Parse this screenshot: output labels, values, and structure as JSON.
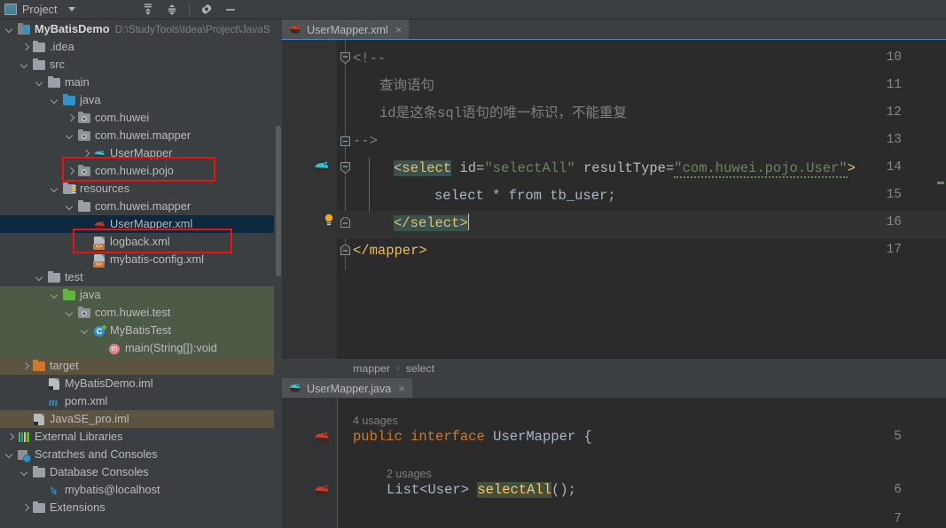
{
  "toolbar": {
    "panel_title": "Project",
    "icons": {
      "project": "project-panel-icon",
      "dropdown": "chevron-down-icon",
      "expand_all": "expand-all-icon",
      "collapse_all": "collapse-all-icon",
      "settings": "gear-icon",
      "hide": "minimize-icon"
    }
  },
  "tree": {
    "items": [
      {
        "label": "MyBatisDemo",
        "path": "D:\\StudyTools\\Idea\\Project\\JavaS",
        "indent": 0,
        "arrow": "down",
        "icon": "module-icon",
        "bold": true,
        "bg": "none"
      },
      {
        "label": ".idea",
        "path": "",
        "indent": 1,
        "arrow": "right",
        "icon": "folder-grey-icon",
        "bold": false,
        "bg": "none"
      },
      {
        "label": "src",
        "path": "",
        "indent": 1,
        "arrow": "down",
        "icon": "folder-grey-icon",
        "bold": false,
        "bg": "none"
      },
      {
        "label": "main",
        "path": "",
        "indent": 2,
        "arrow": "down",
        "icon": "folder-grey-icon",
        "bold": false,
        "bg": "none"
      },
      {
        "label": "java",
        "path": "",
        "indent": 3,
        "arrow": "down",
        "icon": "folder-blue-icon",
        "bold": false,
        "bg": "none"
      },
      {
        "label": "com.huwei",
        "path": "",
        "indent": 4,
        "arrow": "right",
        "icon": "package-icon",
        "bold": false,
        "bg": "none"
      },
      {
        "label": "com.huwei.mapper",
        "path": "",
        "indent": 4,
        "arrow": "down",
        "icon": "package-icon",
        "bold": false,
        "bg": "none"
      },
      {
        "label": "UserMapper",
        "path": "",
        "indent": 5,
        "arrow": "right",
        "icon": "mybatis-mapper-icon",
        "bold": false,
        "bg": "none"
      },
      {
        "label": "com.huwei.pojo",
        "path": "",
        "indent": 4,
        "arrow": "right",
        "icon": "package-icon",
        "bold": false,
        "bg": "none"
      },
      {
        "label": "resources",
        "path": "",
        "indent": 3,
        "arrow": "down",
        "icon": "folder-resources-icon",
        "bold": false,
        "bg": "none"
      },
      {
        "label": "com.huwei.mapper",
        "path": "",
        "indent": 4,
        "arrow": "down",
        "icon": "folder-grey-icon",
        "bold": false,
        "bg": "none"
      },
      {
        "label": "UserMapper.xml",
        "path": "",
        "indent": 5,
        "arrow": "none",
        "icon": "mybatis-file-icon",
        "bold": false,
        "bg": "selected"
      },
      {
        "label": "logback.xml",
        "path": "",
        "indent": 5,
        "arrow": "none",
        "icon": "xml-file-icon",
        "bold": false,
        "bg": "none"
      },
      {
        "label": "mybatis-config.xml",
        "path": "",
        "indent": 5,
        "arrow": "none",
        "icon": "xml-file-icon",
        "bold": false,
        "bg": "none"
      },
      {
        "label": "test",
        "path": "",
        "indent": 2,
        "arrow": "down",
        "icon": "folder-grey-icon",
        "bold": false,
        "bg": "none"
      },
      {
        "label": "java",
        "path": "",
        "indent": 3,
        "arrow": "down",
        "icon": "folder-green-icon",
        "bold": false,
        "bg": "green"
      },
      {
        "label": "com.huwei.test",
        "path": "",
        "indent": 4,
        "arrow": "down",
        "icon": "package-icon",
        "bold": false,
        "bg": "green"
      },
      {
        "label": "MyBatisTest",
        "path": "",
        "indent": 5,
        "arrow": "down",
        "icon": "java-class-icon",
        "bold": false,
        "bg": "green"
      },
      {
        "label": "main(String[]):void",
        "path": "",
        "indent": 6,
        "arrow": "none",
        "icon": "method-icon",
        "bold": false,
        "bg": "green"
      },
      {
        "label": "target",
        "path": "",
        "indent": 1,
        "arrow": "right",
        "icon": "folder-orange-icon",
        "bold": false,
        "bg": "brown"
      },
      {
        "label": "MyBatisDemo.iml",
        "path": "",
        "indent": 2,
        "arrow": "none",
        "icon": "iml-file-icon",
        "bold": false,
        "bg": "none"
      },
      {
        "label": "pom.xml",
        "path": "",
        "indent": 2,
        "arrow": "none",
        "icon": "maven-pom-icon",
        "bold": false,
        "bg": "none"
      },
      {
        "label": "JavaSE_pro.iml",
        "path": "",
        "indent": 1,
        "arrow": "none",
        "icon": "iml-file-icon",
        "bold": false,
        "bg": "brown"
      },
      {
        "label": "External Libraries",
        "path": "",
        "indent": 0,
        "arrow": "right",
        "icon": "external-libraries-icon",
        "bold": false,
        "bg": "none"
      },
      {
        "label": "Scratches and Consoles",
        "path": "",
        "indent": 0,
        "arrow": "down",
        "icon": "scratches-icon",
        "bold": false,
        "bg": "none"
      },
      {
        "label": "Database Consoles",
        "path": "",
        "indent": 1,
        "arrow": "down",
        "icon": "folder-grey-icon",
        "bold": false,
        "bg": "none"
      },
      {
        "label": "mybatis@localhost",
        "path": "",
        "indent": 2,
        "arrow": "none",
        "icon": "database-console-icon",
        "bold": false,
        "bg": "none"
      },
      {
        "label": "Extensions",
        "path": "",
        "indent": 1,
        "arrow": "right",
        "icon": "folder-grey-icon",
        "bold": false,
        "bg": "none"
      }
    ],
    "annotations": [
      {
        "name": "usermapper-interface-highlight",
        "target": "UserMapper"
      },
      {
        "name": "usermapper-xml-highlight",
        "target": "UserMapper.xml"
      }
    ]
  },
  "editor_top": {
    "tab": {
      "label": "UserMapper.xml",
      "icon": "mybatis-file-icon",
      "close": "×"
    },
    "lines": [
      {
        "num": "10",
        "text": "<!--"
      },
      {
        "num": "11",
        "text": "    查询语句"
      },
      {
        "num": "12",
        "text": "    id是这条sql语句的唯一标识，不能重复"
      },
      {
        "num": "13",
        "text": "-->"
      },
      {
        "num": "14",
        "text": "<select id=\"selectAll\" resultType=\"com.huwei.pojo.User\">"
      },
      {
        "num": "15",
        "text": "    select * from tb_user;"
      },
      {
        "num": "16",
        "text": "</select>"
      },
      {
        "num": "17",
        "text": "</mapper>"
      }
    ],
    "l14": {
      "tag_open": "<select",
      "attr1_name": " id=",
      "attr1_value": "\"selectAll\"",
      "attr2_name": " resultType=",
      "attr2_value": "\"com.huwei.pojo.User\"",
      "close": ">"
    },
    "l15": {
      "text": "select * from tb_user;"
    },
    "l16": {
      "text": "</select>"
    },
    "l17": {
      "text": "</mapper>"
    },
    "l10": {
      "text": "<!--"
    },
    "l11": {
      "text": "查询语句"
    },
    "l12": {
      "text": "id是这条sql语句的唯一标识，不能重复"
    },
    "l13": {
      "text": "-->"
    },
    "breadcrumbs": [
      "mapper",
      "select"
    ],
    "breadcrumb_sep": "›",
    "gutter_icons": {
      "line14": "mybatis-navigate-icon",
      "line16": "intention-bulb-icon"
    }
  },
  "editor_bottom": {
    "tab": {
      "label": "UserMapper.java",
      "icon": "mybatis-mapper-icon",
      "close": "×"
    },
    "usages_class": "4 usages",
    "usages_method": "2 usages",
    "lines": [
      {
        "num": "5",
        "text": "public interface UserMapper {"
      },
      {
        "num": "6",
        "text": "    List<User> selectAll();"
      },
      {
        "num": "7",
        "text": ""
      }
    ],
    "l5": {
      "kw1": "public",
      "kw2": "interface",
      "name": "UserMapper",
      "brace": "{"
    },
    "l6": {
      "type": "List<User>",
      "method": "selectAll",
      "tail": "();"
    },
    "gutter_icons": {
      "line5": "mybatis-navigate-icon",
      "line6": "mybatis-navigate-icon"
    }
  },
  "colors": {
    "accent_blue": "#4a88c7",
    "annotation_red": "#ee1111",
    "selection_blue": "#0d293f",
    "test_green": "#4d5a46",
    "target_brown": "#5c5340",
    "editor_bg": "#2b2b2b",
    "gutter_bg": "#313335",
    "panel_bg": "#3c3f41"
  }
}
